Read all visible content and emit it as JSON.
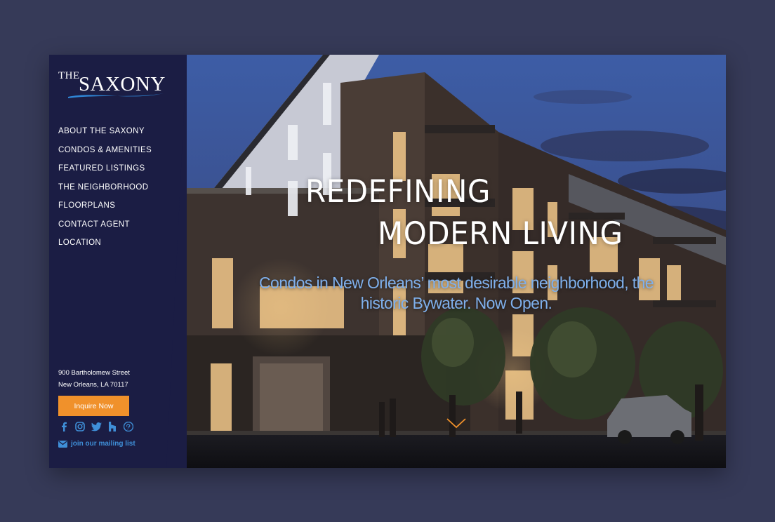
{
  "logo": {
    "small": "THE",
    "main": "SAXONY"
  },
  "nav": {
    "items": [
      "ABOUT THE SAXONY",
      "CONDOS & AMENITIES",
      "FEATURED LISTINGS",
      "THE NEIGHBORHOOD",
      "FLOORPLANS",
      "CONTACT AGENT",
      "LOCATION"
    ]
  },
  "contact": {
    "address_line1": "900 Bartholomew Street",
    "address_line2": "New Orleans, LA 70117",
    "inquire_label": "Inquire Now",
    "mailing_label": "join our mailing list"
  },
  "social": [
    "facebook-icon",
    "instagram-icon",
    "twitter-icon",
    "houzz-icon",
    "pinterest-icon"
  ],
  "hero": {
    "headline_line1": "REDEFINING",
    "headline_line2": "MODERN LIVING",
    "subheadline": "Condos in New Orleans’ most desirable neighborhood, the historic Bywater. Now Open."
  },
  "colors": {
    "page_bg": "#363a58",
    "sidebar_bg": "#1b1d44",
    "accent_orange": "#f0912b",
    "accent_blue": "#3f8fd8",
    "subheadline_blue": "#7fb0ec"
  }
}
